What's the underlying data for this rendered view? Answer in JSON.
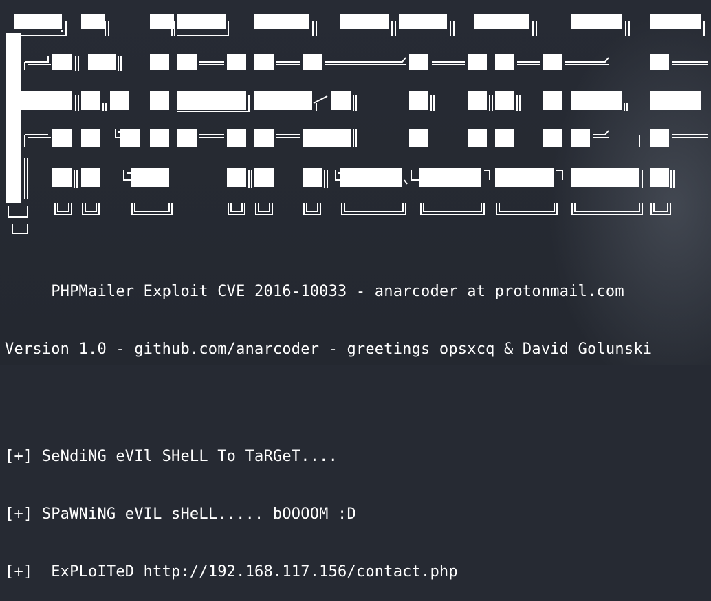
{
  "terminal": {
    "info_line_1": "     PHPMailer Exploit CVE 2016-10033 - anarcoder at protonmail.com",
    "info_line_2": "Version 1.0 - github.com/anarcoder - greetings opsxcq & David Golunski",
    "output": [
      "[+] SeNdiNG eVIl SHeLL To TaRGeT....",
      "[+] SPaWNiNG eVIL sHeLL..... bOOOOM :D",
      "[+]  ExPLoITeD http://192.168.117.156/contact.php"
    ]
  },
  "colors": {
    "background": "#262a33",
    "text": "#ffffff"
  }
}
